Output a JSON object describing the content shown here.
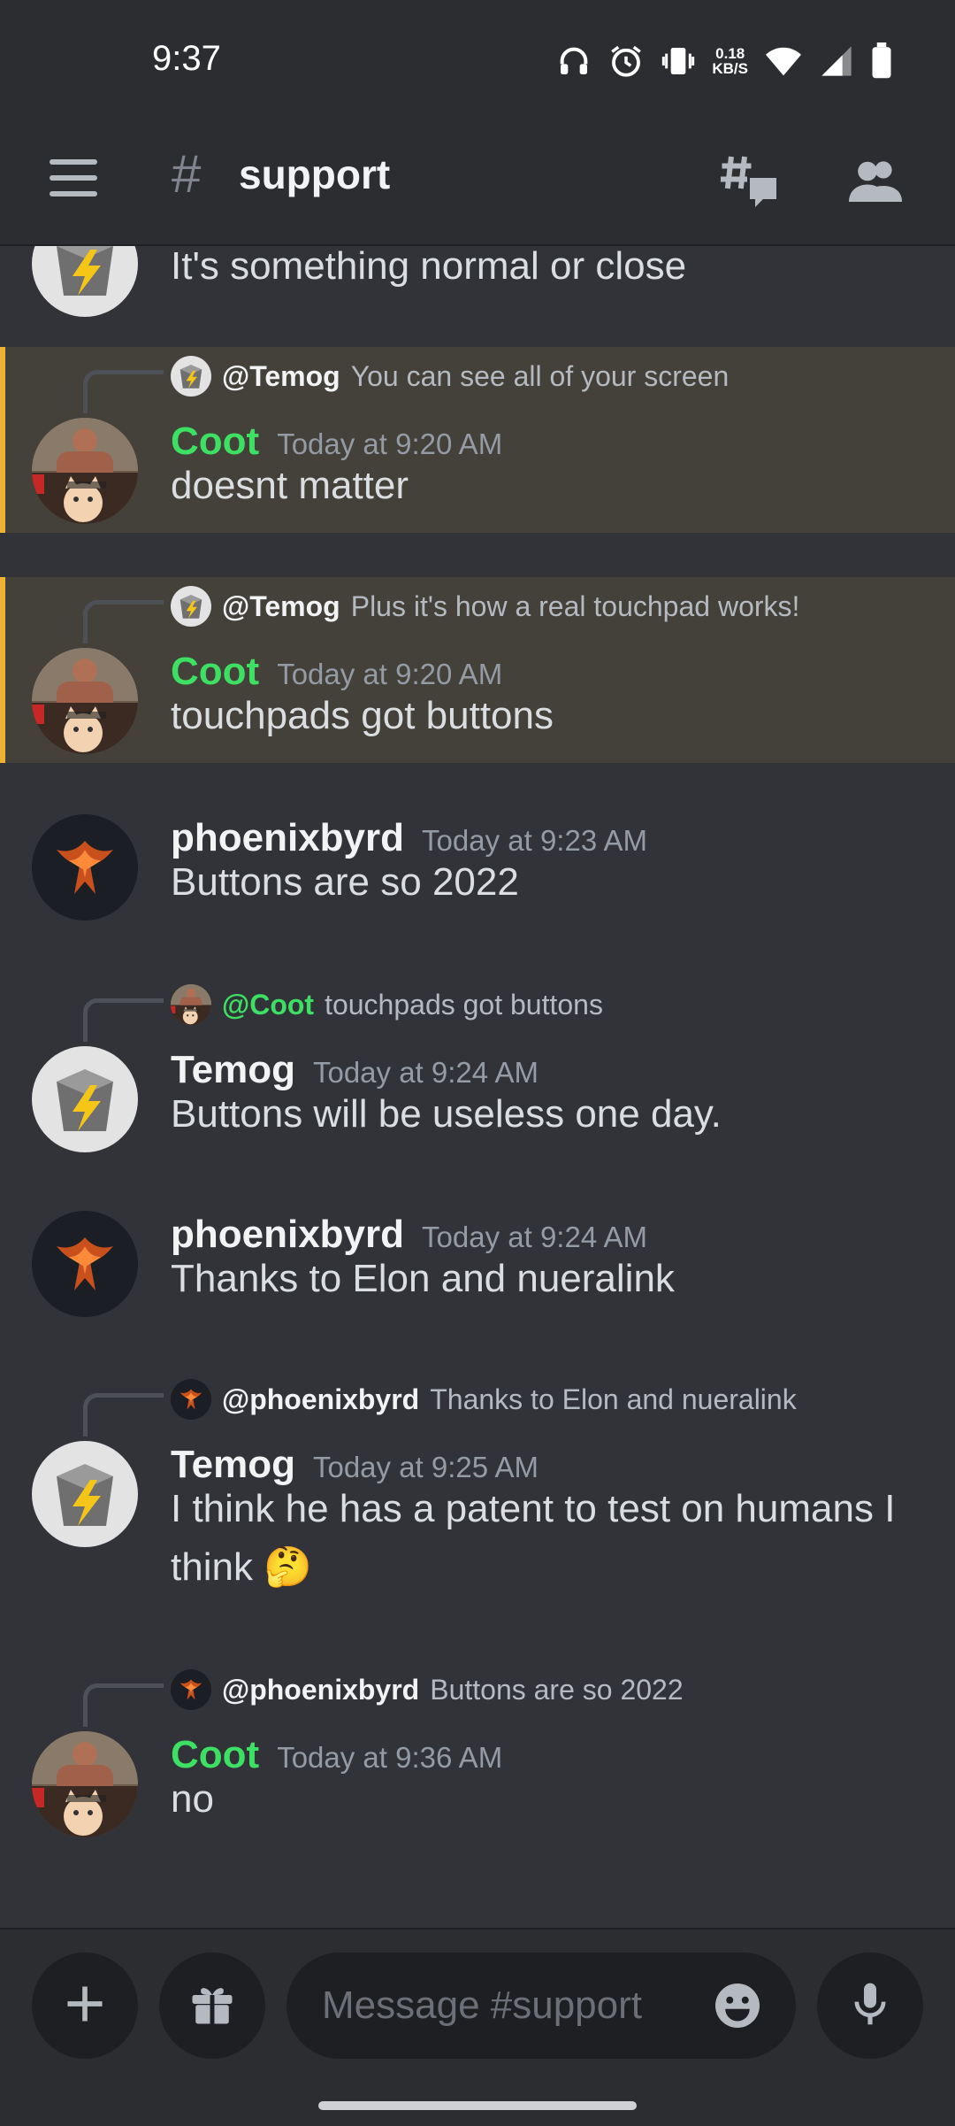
{
  "status_bar": {
    "time": "9:37",
    "net_speed_value": "0.18",
    "net_speed_unit": "KB/S",
    "icons": [
      "headphones-icon",
      "alarm-icon",
      "vibrate-icon",
      "wifi-icon",
      "signal-icon",
      "battery-icon"
    ]
  },
  "header": {
    "hash": "#",
    "channel_name": "support",
    "threads_icon": "threads-icon",
    "members_icon": "members-icon",
    "menu_icon": "hamburger-menu-icon"
  },
  "messages": [
    {
      "content": "It's something normal or close",
      "partial": true
    },
    {
      "highlight": true,
      "reply": {
        "name": "@Temog",
        "text": "You can see all of your screen"
      },
      "author": "Coot",
      "author_color": "#3ee063",
      "timestamp": "Today at 9:20 AM",
      "content": "doesnt matter"
    },
    {
      "highlight": true,
      "reply": {
        "name": "@Temog",
        "text": "Plus it's how a real touchpad works!"
      },
      "author": "Coot",
      "author_color": "#3ee063",
      "timestamp": "Today at 9:20 AM",
      "content": "touchpads got buttons"
    },
    {
      "author": "phoenixbyrd",
      "timestamp": "Today at 9:23 AM",
      "content": "Buttons are so 2022"
    },
    {
      "reply": {
        "name": "@Coot",
        "text": "touchpads got buttons"
      },
      "author": "Temog",
      "timestamp": "Today at 9:24 AM",
      "content": "Buttons will be useless one day."
    },
    {
      "author": "phoenixbyrd",
      "timestamp": "Today at 9:24 AM",
      "content": "Thanks to Elon and nueralink"
    },
    {
      "reply": {
        "name": "@phoenixbyrd",
        "text": "Thanks to Elon and nueralink"
      },
      "author": "Temog",
      "timestamp": "Today at 9:25 AM",
      "content": "I think he has a patent to test on humans I think",
      "emoji": "🤔"
    },
    {
      "reply": {
        "name": "@phoenixbyrd",
        "text": "Buttons are so 2022"
      },
      "author": "Coot",
      "author_color": "#3ee063",
      "timestamp": "Today at 9:36 AM",
      "content": "no"
    }
  ],
  "composer": {
    "placeholder": "Message #support",
    "add_icon": "plus-icon",
    "gift_icon": "gift-icon",
    "emoji_icon": "emoji-icon",
    "mic_icon": "microphone-icon"
  },
  "colors": {
    "background": "#313338",
    "header": "#2b2d31",
    "highlight": "#44403a",
    "highlight_bar": "#f0b232",
    "coot_name": "#3ee063"
  }
}
